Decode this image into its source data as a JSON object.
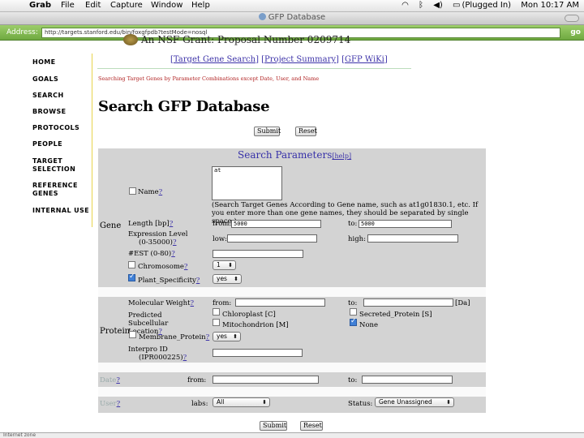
{
  "menubar": {
    "app": "Grab",
    "items": [
      "File",
      "Edit",
      "Capture",
      "Window",
      "Help"
    ],
    "tray": {
      "battery": "(Plugged In)",
      "clock": "Mon 10:17 AM"
    }
  },
  "window": {
    "title": "GFP Database"
  },
  "address": {
    "label": "Address:",
    "url": "http://targets.stanford.edu/bin/foxgfpdb?testMode=nosql",
    "go": "go"
  },
  "sidebar": {
    "items": [
      "HOME",
      "GOALS",
      "SEARCH",
      "BROWSE",
      "PROTOCOLS",
      "PEOPLE",
      "TARGET SELECTION",
      "REFERENCE GENES",
      "INTERNAL USE"
    ]
  },
  "header": {
    "grant": "An NSF Grant: Proposal Number 0209714",
    "links": [
      "Target Gene Search",
      "Project Summary",
      "GFP WiKi"
    ],
    "hint": "Searching Target Genes by Parameter Combinations except Date, User, and Name",
    "title": "Search GFP Database"
  },
  "buttons": {
    "submit": "Submit",
    "reset": "Reset"
  },
  "params": {
    "title": "Search Parameters",
    "help": "[help]"
  },
  "gene": {
    "group": "Gene",
    "name_label": "Name",
    "name_value": "at",
    "name_hint": "(Search Target Genes According to Gene name, such as at1g01830.1, etc. If you enter more than one gene names, they should be separated by single space.)",
    "length_label": "Length [bp]",
    "from_label": "from:",
    "from_value": "5000",
    "to_label": "to:",
    "to_value": "5000",
    "expr_label": "Expression Level",
    "expr_range": "(0-35000)",
    "low_label": "low:",
    "high_label": "high:",
    "est_label": "#EST (0-80)",
    "chromosome_label": "Chromosome",
    "chromosome_value": "1",
    "plant_label": "Plant_Specificity",
    "plant_value": "yes",
    "q": "?"
  },
  "protein": {
    "group": "Protein",
    "mw_label": "Molecular Weight",
    "from_label": "from:",
    "to_label": "to:",
    "unit": "[Da]",
    "loc_label": "Predicted Subcellular Location",
    "loc_options": [
      "Chloroplast [C]",
      "Mitochondrion  [M]",
      "Secreted_Protein  [S]",
      "None"
    ],
    "membrane_label": "Membrane_Protein",
    "membrane_value": "yes",
    "interpro_label": "Interpro ID",
    "interpro_example": "(IPR000225)"
  },
  "date": {
    "label": "Date",
    "from_label": "from:",
    "to_label": "to:"
  },
  "user": {
    "label": "User",
    "labs_label": "labs:",
    "labs_value": "All",
    "status_label": "Status:",
    "status_value": "Gene Unassigned"
  },
  "statusbar": {
    "text": "Internet zone"
  }
}
